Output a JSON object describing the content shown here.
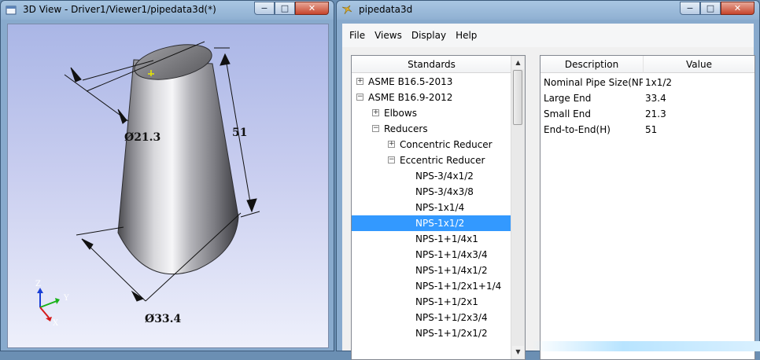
{
  "viewer": {
    "title": "3D View - Driver1/Viewer1/pipedata3d(*)",
    "dim_small": "Ø21.3",
    "dim_large": "Ø33.4",
    "dim_height": "51",
    "axes": {
      "z": "Z",
      "y": "Y",
      "x": "X"
    }
  },
  "app": {
    "title": "pipedata3d",
    "menu": [
      "File",
      "Views",
      "Display",
      "Help"
    ]
  },
  "window_controls": {
    "minimize": "−",
    "maximize": "□",
    "close": "✕"
  },
  "tree": {
    "header": "Standards",
    "items": [
      {
        "label": "ASME B16.5-2013",
        "expander": "+"
      },
      {
        "label": "ASME B16.9-2012",
        "expander": "−"
      },
      {
        "label": "Elbows",
        "expander": "+"
      },
      {
        "label": "Reducers",
        "expander": "−"
      },
      {
        "label": "Concentric Reducer",
        "expander": "+"
      },
      {
        "label": "Eccentric Reducer",
        "expander": "−"
      },
      {
        "label": "NPS-3/4x1/2"
      },
      {
        "label": "NPS-3/4x3/8"
      },
      {
        "label": "NPS-1x1/4"
      },
      {
        "label": "NPS-1x1/2",
        "selected": true
      },
      {
        "label": "NPS-1+1/4x1"
      },
      {
        "label": "NPS-1+1/4x3/4"
      },
      {
        "label": "NPS-1+1/4x1/2"
      },
      {
        "label": "NPS-1+1/2x1+1/4"
      },
      {
        "label": "NPS-1+1/2x1"
      },
      {
        "label": "NPS-1+1/2x3/4"
      },
      {
        "label": "NPS-1+1/2x1/2"
      }
    ]
  },
  "properties": {
    "header_description": "Description",
    "header_value": "Value",
    "rows": [
      {
        "description": "Nominal Pipe Size(NPS",
        "value": "1x1/2"
      },
      {
        "description": "Large End",
        "value": "33.4"
      },
      {
        "description": "Small End",
        "value": "21.3"
      },
      {
        "description": "End-to-End(H)",
        "value": "51"
      }
    ]
  },
  "colors": {
    "selection": "#3399ff",
    "titlebar": "#a9c6e2"
  }
}
